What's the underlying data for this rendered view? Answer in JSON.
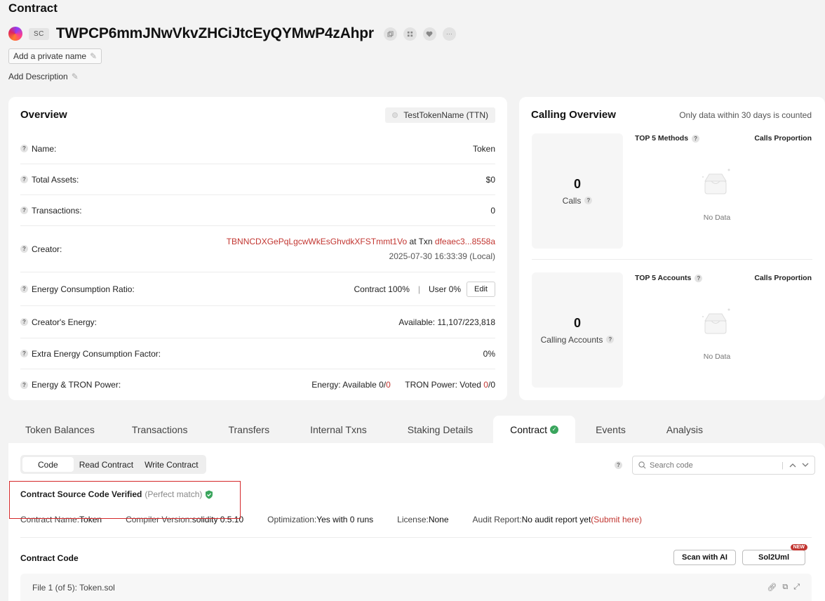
{
  "page": {
    "heading": "Contract",
    "badge": "SC",
    "address": "TWPCP6mmJNwVkvZHCiJtcEyQYMwP4zAhpr",
    "private_name_label": "Add a private name",
    "add_description_label": "Add Description"
  },
  "overview": {
    "title": "Overview",
    "token_pill": "TestTokenName (TTN)",
    "rows": {
      "name": {
        "label": "Name:",
        "value": "Token"
      },
      "total_assets": {
        "label": "Total Assets:",
        "value": "$0"
      },
      "transactions": {
        "label": "Transactions:",
        "value": "0"
      },
      "creator": {
        "label": "Creator:",
        "address": "TBNNCDXGePqLgcwWkEsGhvdkXFSTmmt1Vo",
        "at_txn": " at Txn ",
        "txn": "dfeaec3...8558a",
        "time": "2025-07-30 16:33:39 (Local)"
      },
      "energy_ratio": {
        "label": "Energy Consumption Ratio:",
        "contract": "Contract 100%",
        "separator": "|",
        "user": "User 0%",
        "edit": "Edit"
      },
      "creator_energy": {
        "label": "Creator's Energy:",
        "value": "Available: 11,107/223,818"
      },
      "extra_factor": {
        "label": "Extra Energy Consumption Factor:",
        "value": "0%"
      },
      "energy_power": {
        "label": "Energy & TRON Power:",
        "energy_prefix": "Energy: Available 0/",
        "energy_red": "0",
        "power_prefix": "TRON Power: Voted ",
        "power_red": "0",
        "power_suffix": "/0"
      }
    }
  },
  "calling": {
    "title": "Calling Overview",
    "subtitle": "Only data within 30 days is counted",
    "calls": {
      "value": "0",
      "label": "Calls"
    },
    "accounts": {
      "value": "0",
      "label": "Calling Accounts"
    },
    "methods_title": "TOP 5 Methods",
    "accounts_title": "TOP 5 Accounts",
    "proportion": "Calls Proportion",
    "no_data": "No Data"
  },
  "tabs": [
    {
      "label": "Token Balances"
    },
    {
      "label": "Transactions"
    },
    {
      "label": "Transfers"
    },
    {
      "label": "Internal Txns"
    },
    {
      "label": "Staking Details"
    },
    {
      "label": "Contract"
    },
    {
      "label": "Events"
    },
    {
      "label": "Analysis"
    }
  ],
  "contract": {
    "segments": [
      "Code",
      "Read Contract",
      "Write Contract"
    ],
    "search_placeholder": "Search code",
    "verified_title": "Contract Source Code Verified",
    "verified_note": "(Perfect match)",
    "meta": {
      "name_label": "Contract Name:",
      "name_value": "Token",
      "compiler_label": "Compiler Version:",
      "compiler_value": "solidity 0.5.10",
      "optimization_label": "Optimization:",
      "optimization_value": "Yes with 0 runs",
      "license_label": "License:",
      "license_value": "None",
      "audit_label": "Audit Report:",
      "audit_value": "No audit report yet",
      "audit_link": "(Submit here)"
    },
    "code_heading": "Contract Code",
    "scan_button": "Scan with AI",
    "sol2uml_button": "Sol2Uml",
    "new_badge": "NEW",
    "file_label": "File 1 (of 5): Token.sol"
  },
  "colors": {
    "accent_red": "#c23631",
    "verified_green": "#3aa55d",
    "highlight_border": "#d4282a"
  }
}
